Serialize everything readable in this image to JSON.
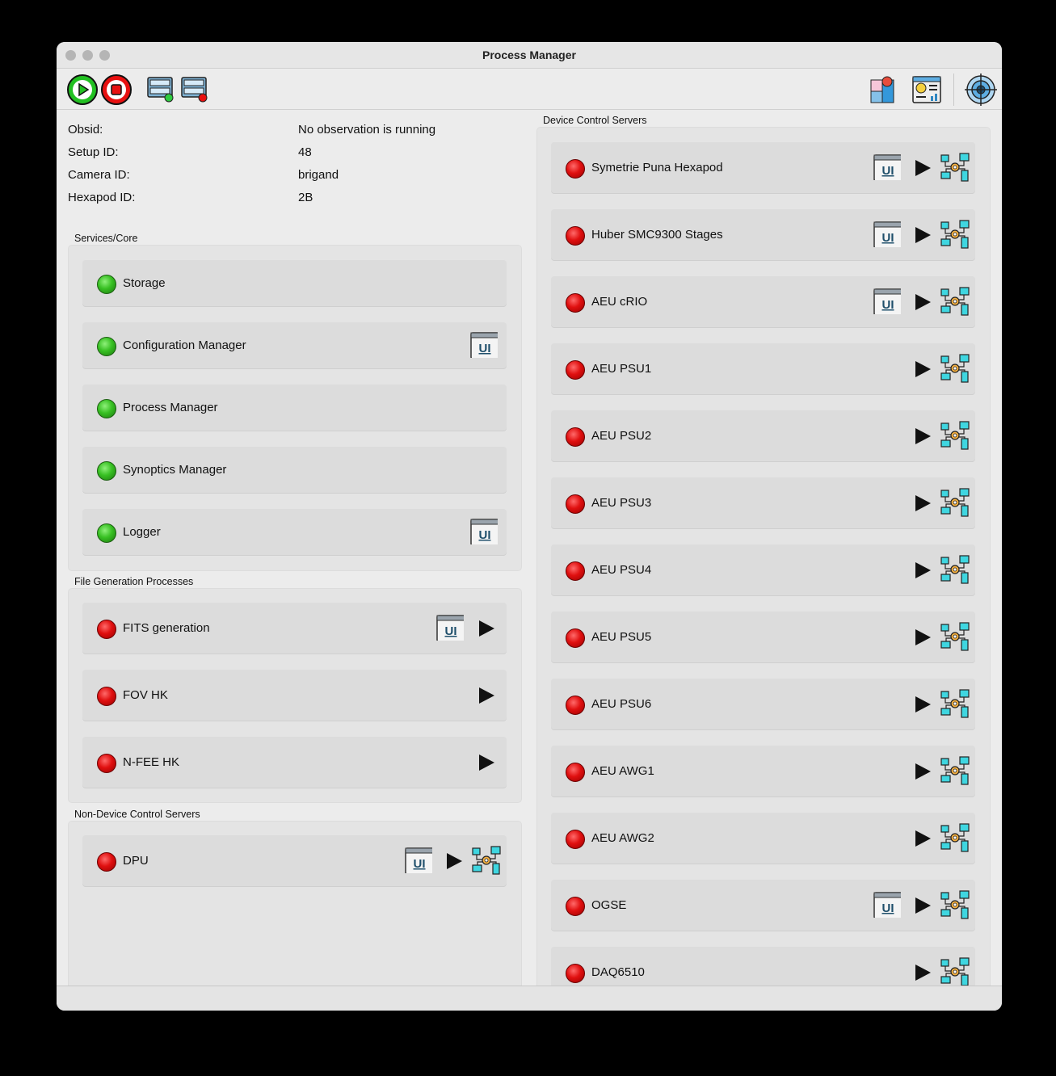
{
  "window": {
    "title": "Process Manager"
  },
  "info": {
    "obsid_label": "Obsid:",
    "obsid_value": "No observation is running",
    "setup_label": "Setup ID:",
    "setup_value": "48",
    "camera_label": "Camera ID:",
    "camera_value": "brigand",
    "hexapod_label": "Hexapod ID:",
    "hexapod_value": "2B"
  },
  "groups": {
    "services": "Services/Core",
    "filegen": "File Generation Processes",
    "nondevice": "Non-Device Control Servers",
    "device": "Device Control Servers"
  },
  "services": [
    {
      "label": "Storage",
      "status": "green",
      "ui": false
    },
    {
      "label": "Configuration Manager",
      "status": "green",
      "ui": true
    },
    {
      "label": "Process Manager",
      "status": "green",
      "ui": false
    },
    {
      "label": "Synoptics Manager",
      "status": "green",
      "ui": false
    },
    {
      "label": "Logger",
      "status": "green",
      "ui": true
    }
  ],
  "filegen": [
    {
      "label": "FITS generation",
      "status": "red",
      "ui": true,
      "play": true
    },
    {
      "label": "FOV HK",
      "status": "red",
      "ui": false,
      "play": true
    },
    {
      "label": "N-FEE HK",
      "status": "red",
      "ui": false,
      "play": true
    }
  ],
  "nondevice": [
    {
      "label": "DPU",
      "status": "red",
      "ui": true,
      "play": true,
      "net": true
    }
  ],
  "device": [
    {
      "label": "Symetrie Puna Hexapod",
      "status": "red",
      "ui": true
    },
    {
      "label": "Huber SMC9300 Stages",
      "status": "red",
      "ui": true
    },
    {
      "label": "AEU cRIO",
      "status": "red",
      "ui": true
    },
    {
      "label": "AEU PSU1",
      "status": "red",
      "ui": false
    },
    {
      "label": "AEU PSU2",
      "status": "red",
      "ui": false
    },
    {
      "label": "AEU PSU3",
      "status": "red",
      "ui": false
    },
    {
      "label": "AEU PSU4",
      "status": "red",
      "ui": false
    },
    {
      "label": "AEU PSU5",
      "status": "red",
      "ui": false
    },
    {
      "label": "AEU PSU6",
      "status": "red",
      "ui": false
    },
    {
      "label": "AEU AWG1",
      "status": "red",
      "ui": false
    },
    {
      "label": "AEU AWG2",
      "status": "red",
      "ui": false
    },
    {
      "label": "OGSE",
      "status": "red",
      "ui": true
    },
    {
      "label": "DAQ6510",
      "status": "red",
      "ui": false
    }
  ],
  "icons": {
    "ui_text": "UI",
    "start_all": "play-circle-icon",
    "stop_all": "stop-circle-icon",
    "start_servers": "server-rack-play-icon",
    "stop_servers": "server-rack-stop-icon",
    "map": "map-pin-icon",
    "dashboard": "dashboard-icon",
    "target": "target-icon"
  },
  "colors": {
    "green_led": "#38c023",
    "red_led": "#e01010",
    "start": "#22c022",
    "stop": "#e81010"
  }
}
